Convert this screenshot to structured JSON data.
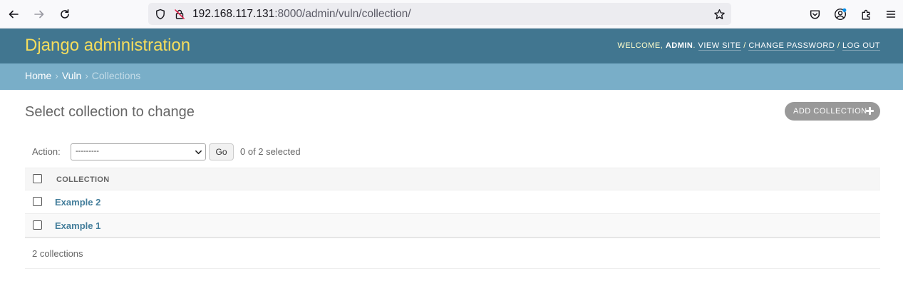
{
  "browser": {
    "url_host": "192.168.117.131",
    "url_rest": ":8000/admin/vuln/collection/",
    "icons": [
      "back-arrow-icon",
      "forward-arrow-icon",
      "reload-icon",
      "shield-icon",
      "insecure-lock-icon",
      "bookmark-star-icon",
      "pocket-icon",
      "account-icon",
      "extensions-icon",
      "menu-icon"
    ]
  },
  "header": {
    "branding": "Django administration",
    "welcome": "WELCOME,",
    "username": "ADMIN",
    "view_site": "VIEW SITE",
    "change_password": "CHANGE PASSWORD",
    "log_out": "LOG OUT",
    "separator": "/"
  },
  "breadcrumbs": {
    "home": "Home",
    "app": "Vuln",
    "current": "Collections",
    "separator": "›"
  },
  "content": {
    "title": "Select collection to change",
    "add_button": "ADD COLLECTION",
    "action_label": "Action:",
    "action_selected": "---------",
    "go_label": "Go",
    "selected_count": "0 of 2 selected",
    "column_header": "COLLECTION",
    "rows": [
      {
        "label": "Example 2"
      },
      {
        "label": "Example 1"
      }
    ],
    "paginator": "2 collections"
  },
  "colors": {
    "header_bg": "#417690",
    "branding": "#f5dd5d",
    "breadcrumbs_bg": "#79aec8",
    "link": "#447e9b",
    "add_button_bg": "#999999"
  }
}
